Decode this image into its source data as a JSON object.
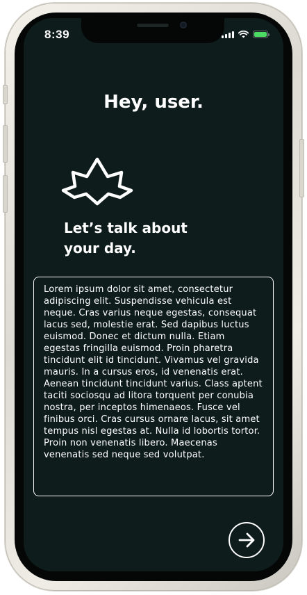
{
  "status_bar": {
    "time": "8:39",
    "battery_color": "#4cd964"
  },
  "greeting": {
    "text": "Hey, user."
  },
  "hero": {
    "icon": "lotus-icon"
  },
  "prompt": {
    "text": "Let’s talk about your day."
  },
  "journal": {
    "text": "Lorem ipsum dolor sit amet, consectetur adipiscing elit. Suspendisse vehicula est neque. Cras varius neque egestas, consequat lacus sed, molestie erat. Sed dapibus luctus euismod. Donec et dictum nulla. Etiam egestas fringilla euismod. Proin pharetra tincidunt elit id tincidunt. Vivamus vel gravida mauris. In a cursus eros, id venenatis erat. Aenean tincidunt tincidunt varius. Class aptent taciti sociosqu ad litora torquent per conubia nostra, per inceptos himenaeos. Fusce vel finibus orci. Cras cursus ornare lacus, sit amet tempus nisl egestas at. Nulla id lobortis tortor. Proin non venenatis libero. Maecenas venenatis sed neque sed volutpat."
  },
  "next_button": {
    "icon": "arrow-right-icon"
  },
  "colors": {
    "background": "#0f1c1c",
    "foreground": "#ffffff"
  }
}
